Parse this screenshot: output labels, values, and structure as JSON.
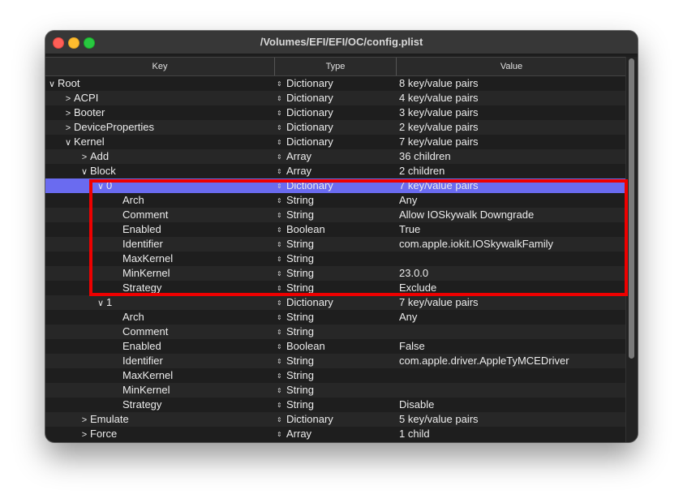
{
  "window": {
    "title": "/Volumes/EFI/EFI/OC/config.plist"
  },
  "columns": {
    "key": "Key",
    "type": "Type",
    "value": "Value"
  },
  "rows": [
    {
      "key": "Root",
      "type": "Dictionary",
      "value": "8 key/value pairs",
      "disclosure": "expanded"
    },
    {
      "key": "ACPI",
      "type": "Dictionary",
      "value": "4 key/value pairs",
      "disclosure": "collapsed"
    },
    {
      "key": "Booter",
      "type": "Dictionary",
      "value": "3 key/value pairs",
      "disclosure": "collapsed"
    },
    {
      "key": "DeviceProperties",
      "type": "Dictionary",
      "value": "2 key/value pairs",
      "disclosure": "collapsed"
    },
    {
      "key": "Kernel",
      "type": "Dictionary",
      "value": "7 key/value pairs",
      "disclosure": "expanded"
    },
    {
      "key": "Add",
      "type": "Array",
      "value": "36 children",
      "disclosure": "collapsed"
    },
    {
      "key": "Block",
      "type": "Array",
      "value": "2 children",
      "disclosure": "expanded"
    },
    {
      "key": "0",
      "type": "Dictionary",
      "value": "7 key/value pairs",
      "disclosure": "expanded",
      "selected": true
    },
    {
      "key": "Arch",
      "type": "String",
      "value": "Any"
    },
    {
      "key": "Comment",
      "type": "String",
      "value": "Allow IOSkywalk Downgrade"
    },
    {
      "key": "Enabled",
      "type": "Boolean",
      "value": "True"
    },
    {
      "key": "Identifier",
      "type": "String",
      "value": "com.apple.iokit.IOSkywalkFamily"
    },
    {
      "key": "MaxKernel",
      "type": "String",
      "value": ""
    },
    {
      "key": "MinKernel",
      "type": "String",
      "value": "23.0.0"
    },
    {
      "key": "Strategy",
      "type": "String",
      "value": "Exclude"
    },
    {
      "key": "1",
      "type": "Dictionary",
      "value": "7 key/value pairs",
      "disclosure": "expanded"
    },
    {
      "key": "Arch",
      "type": "String",
      "value": "Any"
    },
    {
      "key": "Comment",
      "type": "String",
      "value": ""
    },
    {
      "key": "Enabled",
      "type": "Boolean",
      "value": "False"
    },
    {
      "key": "Identifier",
      "type": "String",
      "value": "com.apple.driver.AppleTyMCEDriver"
    },
    {
      "key": "MaxKernel",
      "type": "String",
      "value": ""
    },
    {
      "key": "MinKernel",
      "type": "String",
      "value": ""
    },
    {
      "key": "Strategy",
      "type": "String",
      "value": "Disable"
    },
    {
      "key": "Emulate",
      "type": "Dictionary",
      "value": "5 key/value pairs",
      "disclosure": "collapsed"
    },
    {
      "key": "Force",
      "type": "Array",
      "value": "1 child",
      "disclosure": "collapsed"
    }
  ],
  "icons": {
    "expanded": "chevron-down-icon",
    "collapsed": "chevron-right-icon",
    "type_stepper": "up-down-arrows-icon"
  },
  "colors": {
    "selection": "#6a6bf0",
    "annotation_box": "#ee0000"
  }
}
